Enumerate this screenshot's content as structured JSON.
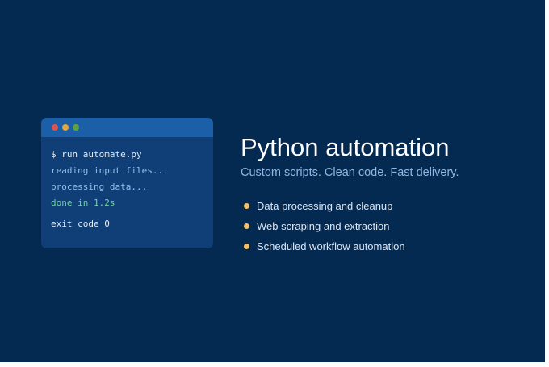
{
  "colors": {
    "background": "#052a52",
    "terminal_body": "#0f3f76",
    "terminal_titlebar": "#1b5fa8",
    "dot_red": "#e0524b",
    "dot_yellow": "#e5a537",
    "dot_green": "#5fa33f",
    "bullet": "#f2c06a",
    "success_text": "#6fd3a0"
  },
  "terminal": {
    "window_controls": [
      "close-dot",
      "minimize-dot",
      "maximize-dot"
    ],
    "lines": [
      {
        "text": "$ run automate.py",
        "kind": "cmd"
      },
      {
        "text": "reading input files...",
        "kind": "info"
      },
      {
        "text": "processing data...",
        "kind": "info"
      },
      {
        "text": "done in 1.2s",
        "kind": "ok"
      },
      {
        "text": "exit code 0",
        "kind": "exit"
      }
    ]
  },
  "hero": {
    "title": "Python automation",
    "subtitle": "Custom scripts. Clean code. Fast delivery."
  },
  "features": [
    "Data processing and cleanup",
    "Web scraping and extraction",
    "Scheduled workflow automation"
  ]
}
